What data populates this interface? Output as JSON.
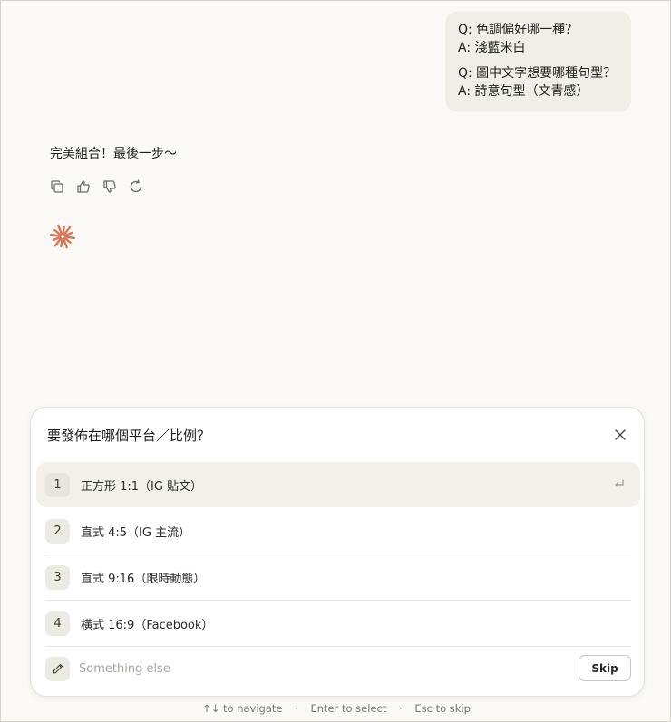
{
  "user_message": {
    "qa": [
      {
        "q": "Q: 色調偏好哪一種？",
        "a": "A: 淺藍米白"
      },
      {
        "q": "Q: 圖中文字想要哪種句型？",
        "a": "A: 詩意句型（文青感）"
      }
    ]
  },
  "assistant": {
    "text": "完美組合！最後一步～",
    "actions": [
      "copy-icon",
      "thumbs-up-icon",
      "thumbs-down-icon",
      "retry-icon"
    ]
  },
  "question_panel": {
    "title": "要發佈在哪個平台／比例？",
    "options": [
      {
        "number": "1",
        "label": "正方形 1:1（IG 貼文）",
        "selected": true
      },
      {
        "number": "2",
        "label": "直式 4:5（IG 主流）",
        "selected": false
      },
      {
        "number": "3",
        "label": "直式 9:16（限時動態）",
        "selected": false
      },
      {
        "number": "4",
        "label": "橫式 16:9（Facebook）",
        "selected": false
      }
    ],
    "other_placeholder": "Something else",
    "skip_label": "Skip"
  },
  "hints": {
    "navigate": "↑↓ to navigate",
    "select": "Enter to select",
    "skip": "Esc to skip",
    "separator": "·"
  },
  "colors": {
    "background": "#faf9f5",
    "bubble": "#f0eee6",
    "accent": "#d97757"
  }
}
